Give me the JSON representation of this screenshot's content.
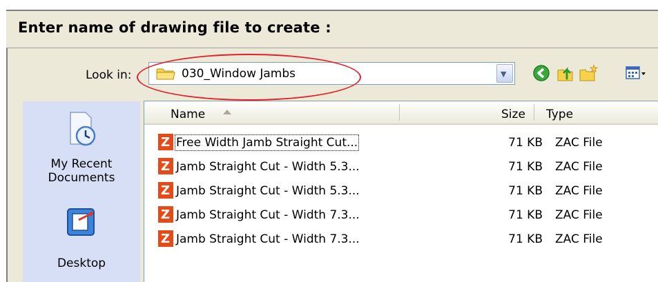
{
  "dialog": {
    "title": "Enter name of drawing file to create :"
  },
  "look_in": {
    "label": "Look in:",
    "value": "030_Window Jambs"
  },
  "toolbar": {
    "icons": [
      "back-icon",
      "up-folder-icon",
      "new-folder-icon",
      "views-menu-icon"
    ]
  },
  "places": [
    {
      "label_line1": "My Recent",
      "label_line2": "Documents",
      "icon": "recent-documents-icon"
    },
    {
      "label_line1": "Desktop",
      "label_line2": "",
      "icon": "desktop-icon"
    }
  ],
  "file_list": {
    "columns": {
      "name": "Name",
      "size": "Size",
      "type": "Type"
    },
    "rows": [
      {
        "name": "Free Width Jamb Straight Cut...",
        "size": "71 KB",
        "type": "ZAC File",
        "icon_letter": "Z"
      },
      {
        "name": "Jamb Straight Cut - Width 5.3...",
        "size": "71 KB",
        "type": "ZAC File",
        "icon_letter": "Z"
      },
      {
        "name": "Jamb Straight Cut - Width 5.3...",
        "size": "71 KB",
        "type": "ZAC File",
        "icon_letter": "Z"
      },
      {
        "name": "Jamb Straight Cut - Width 7.3...",
        "size": "71 KB",
        "type": "ZAC File",
        "icon_letter": "Z"
      },
      {
        "name": "Jamb Straight Cut - Width 7.3...",
        "size": "71 KB",
        "type": "ZAC File",
        "icon_letter": "Z"
      }
    ]
  },
  "colors": {
    "annotation_ellipse": "#e3202a",
    "zac_icon": "#e64a19",
    "places_bar": "#d6dff5"
  }
}
